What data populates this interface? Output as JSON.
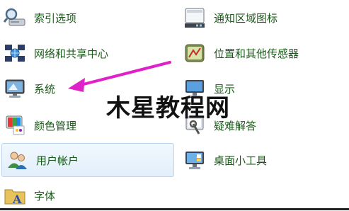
{
  "left_items": [
    {
      "label": "索引选项",
      "icon": "magnifier-over-drive-icon"
    },
    {
      "label": "网络和共享中心",
      "icon": "network-globe-icon"
    },
    {
      "label": "系统",
      "icon": "computer-monitor-icon"
    },
    {
      "label": "颜色管理",
      "icon": "color-management-icon"
    },
    {
      "label": "用户帐户",
      "icon": "user-accounts-icon"
    },
    {
      "label": "字体",
      "icon": "fonts-folder-icon"
    }
  ],
  "right_items": [
    {
      "label": "通知区域图标",
      "icon": "notification-area-icon"
    },
    {
      "label": "位置和其他传感器",
      "icon": "location-sensor-icon"
    },
    {
      "label": "显示",
      "icon": "display-icon"
    },
    {
      "label": "疑难解答",
      "icon": "troubleshooting-icon"
    },
    {
      "label": "桌面小工具",
      "icon": "desktop-gadgets-icon"
    }
  ],
  "watermark": "木星教程网",
  "colors": {
    "link": "#1a5a1a",
    "arrow": "#e020c8",
    "selected_bg": "#e6f1fc"
  }
}
